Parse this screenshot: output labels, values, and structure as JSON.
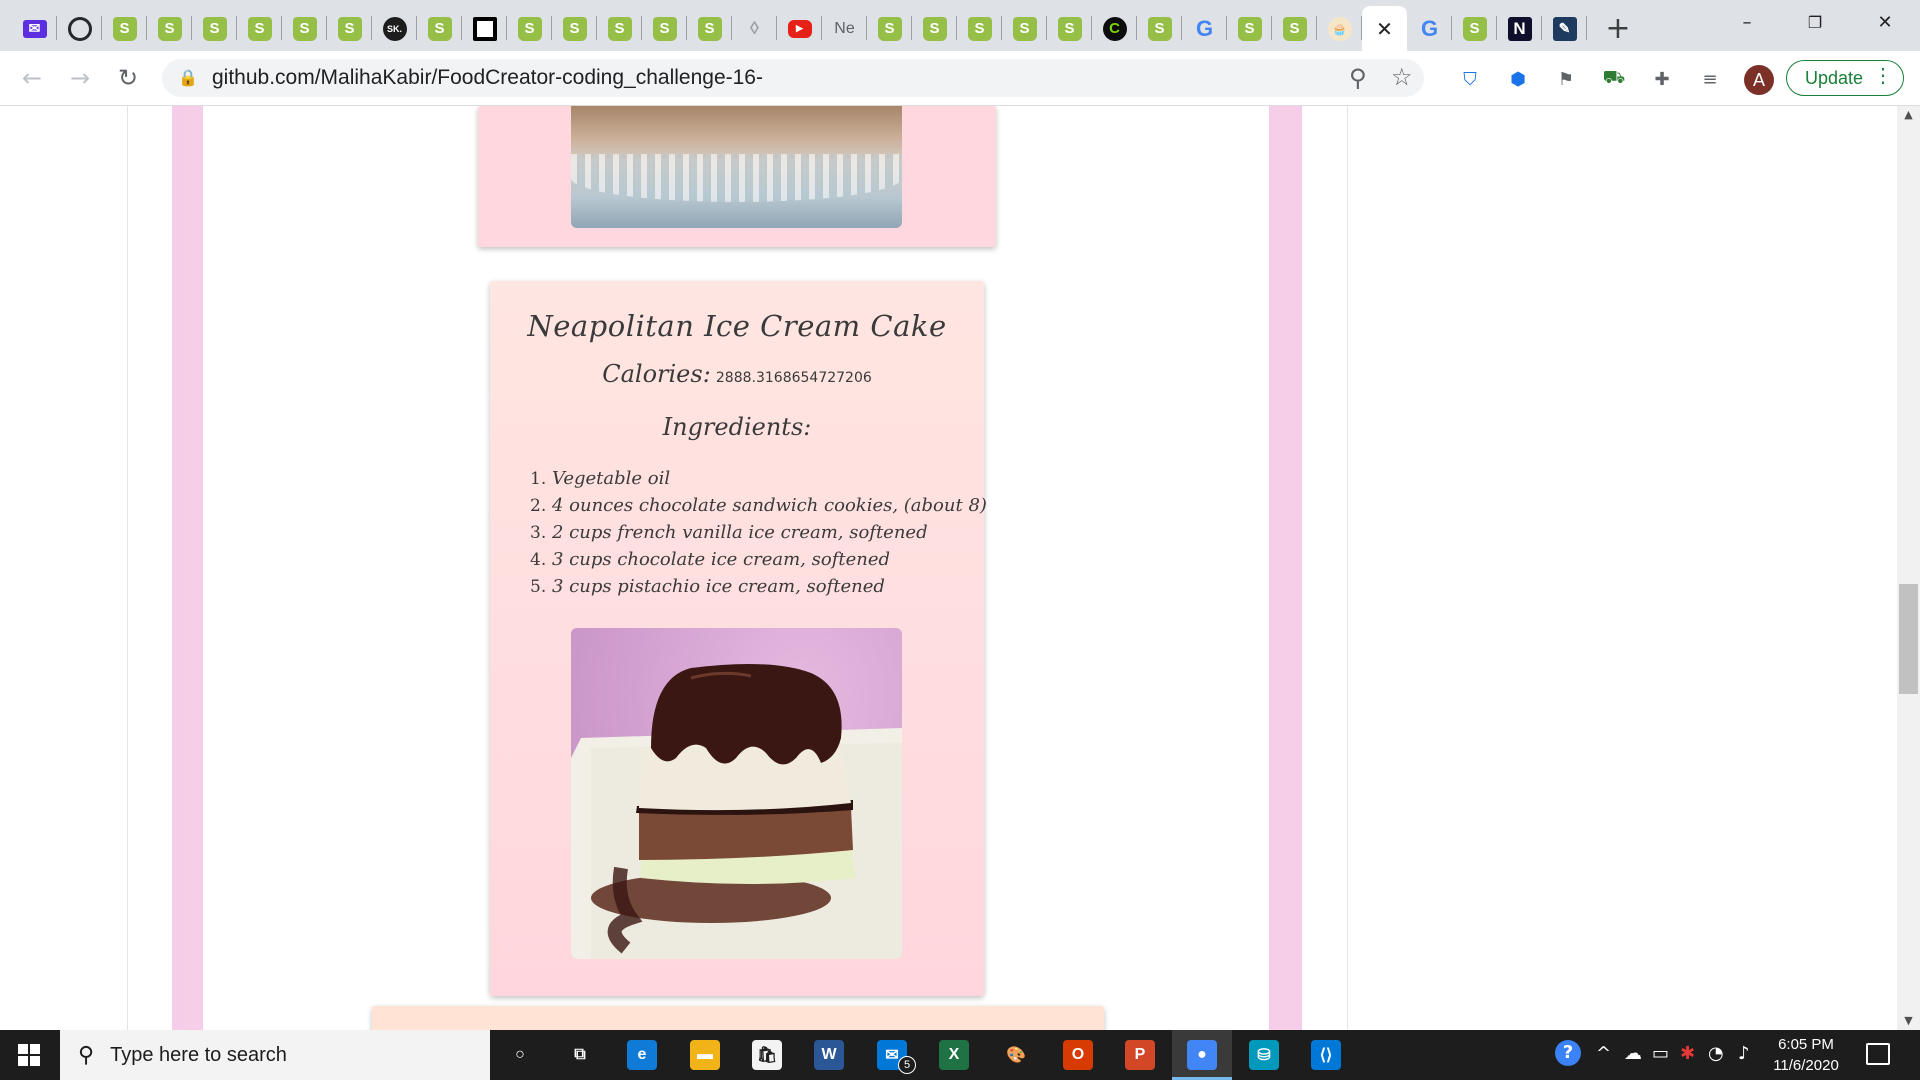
{
  "browser": {
    "tabs": [
      {
        "icon": "gmail-icon",
        "glyph": "✉"
      },
      {
        "icon": "github-icon",
        "glyph": ""
      },
      {
        "icon": "shopify-icon",
        "glyph": "S"
      },
      {
        "icon": "shopify-icon",
        "glyph": "S"
      },
      {
        "icon": "shopify-icon",
        "glyph": "S"
      },
      {
        "icon": "shopify-icon",
        "glyph": "S"
      },
      {
        "icon": "shopify-icon",
        "glyph": "S"
      },
      {
        "icon": "shopify-icon",
        "glyph": "S"
      },
      {
        "icon": "sk-icon",
        "glyph": "SK."
      },
      {
        "icon": "shopify-icon",
        "glyph": "S"
      },
      {
        "icon": "square-icon",
        "glyph": ""
      },
      {
        "icon": "shopify-icon",
        "glyph": "S"
      },
      {
        "icon": "shopify-icon",
        "glyph": "S"
      },
      {
        "icon": "shopify-icon",
        "glyph": "S"
      },
      {
        "icon": "shopify-icon",
        "glyph": "S"
      },
      {
        "icon": "shopify-icon",
        "glyph": "S"
      },
      {
        "icon": "droplet-icon",
        "glyph": "◊"
      },
      {
        "icon": "youtube-icon",
        "glyph": "▶"
      },
      {
        "icon": "ne-tab-label",
        "glyph": "Ne"
      },
      {
        "icon": "shopify-icon",
        "glyph": "S"
      },
      {
        "icon": "shopify-icon",
        "glyph": "S"
      },
      {
        "icon": "shopify-icon",
        "glyph": "S"
      },
      {
        "icon": "shopify-icon",
        "glyph": "S"
      },
      {
        "icon": "shopify-icon",
        "glyph": "S"
      },
      {
        "icon": "c-circle-icon",
        "glyph": "C"
      },
      {
        "icon": "shopify-icon",
        "glyph": "S"
      },
      {
        "icon": "google-icon",
        "glyph": "G"
      },
      {
        "icon": "shopify-icon",
        "glyph": "S"
      },
      {
        "icon": "shopify-icon",
        "glyph": "S"
      },
      {
        "icon": "cupcake-icon",
        "glyph": "🧁"
      },
      {
        "icon": "close-icon",
        "glyph": "✕",
        "active": true
      },
      {
        "icon": "google-icon",
        "glyph": "G"
      },
      {
        "icon": "shopify-icon",
        "glyph": "S"
      },
      {
        "icon": "notion-icon",
        "glyph": "N"
      },
      {
        "icon": "pen-icon",
        "glyph": "✎"
      }
    ],
    "new_tab_glyph": "+",
    "window_controls": {
      "minimize": "–",
      "restore": "❐",
      "close": "✕"
    },
    "back_glyph": "←",
    "forward_glyph": "→",
    "reload_glyph": "↻",
    "url": "github.com/MalihaKabir/FoodCreator-coding_challenge-16-",
    "lock_glyph": "🔒",
    "zoom_glyph": "⚲",
    "star_glyph": "☆",
    "extensions": [
      {
        "name": "shield-extension-icon",
        "glyph": "⛉",
        "color": "#1a73e8"
      },
      {
        "name": "location-extension-icon",
        "glyph": "⬢",
        "color": "#1a73e8"
      },
      {
        "name": "flag-extension-icon",
        "glyph": "⚑",
        "color": "#5f6368"
      },
      {
        "name": "cart-extension-icon",
        "glyph": "⛟",
        "color": "#2e7d32"
      },
      {
        "name": "puzzle-extensions-icon",
        "glyph": "✚",
        "color": "#5f6368"
      },
      {
        "name": "media-playlist-icon",
        "glyph": "≡",
        "color": "#5f6368"
      }
    ],
    "avatar_letter": "A",
    "update_label": "Update",
    "menu_glyph": "⋮"
  },
  "page": {
    "recipe": {
      "title": "Neapolitan Ice Cream Cake",
      "calories_label": "Calories:",
      "calories_value": "2888.3168654727206",
      "ingredients_heading": "Ingredients:",
      "ingredients": [
        {
          "num": "1.",
          "text": "Vegetable oil"
        },
        {
          "num": "2.",
          "text": "4 ounces chocolate sandwich cookies, (about 8)"
        },
        {
          "num": "3.",
          "text": "2 cups french vanilla ice cream, softened"
        },
        {
          "num": "4.",
          "text": "3 cups chocolate ice cream, softened"
        },
        {
          "num": "5.",
          "text": "3 cups pistachio ice cream, softened"
        }
      ]
    }
  },
  "taskbar": {
    "search_placeholder": "Type here to search",
    "apps": [
      {
        "name": "cortana-icon",
        "glyph": "○",
        "color": "transparent"
      },
      {
        "name": "task-view-icon",
        "glyph": "⧉",
        "color": "transparent"
      },
      {
        "name": "edge-icon",
        "glyph": "e",
        "color": "#0f7bd6"
      },
      {
        "name": "file-explorer-icon",
        "glyph": "▬",
        "color": "#f2b318"
      },
      {
        "name": "store-icon",
        "glyph": "🛍",
        "color": "#f3f3f3"
      },
      {
        "name": "word-icon",
        "glyph": "W",
        "color": "#2b5797"
      },
      {
        "name": "mail-icon",
        "glyph": "✉",
        "color": "#0078d7",
        "badge": "5"
      },
      {
        "name": "excel-icon",
        "glyph": "X",
        "color": "#1f7244"
      },
      {
        "name": "paint-icon",
        "glyph": "🎨",
        "color": "transparent"
      },
      {
        "name": "office-icon",
        "glyph": "O",
        "color": "#d83b01"
      },
      {
        "name": "powerpoint-icon",
        "glyph": "P",
        "color": "#d24726"
      },
      {
        "name": "chrome-icon",
        "glyph": "●",
        "color": "#4285f4",
        "active": true
      },
      {
        "name": "teams-icon",
        "glyph": "⛁",
        "color": "#0099bc"
      },
      {
        "name": "vscode-icon",
        "glyph": "⟨⟩",
        "color": "#0078d7"
      }
    ],
    "time": "6:05 PM",
    "date": "11/6/2020"
  },
  "colors": {
    "pink_frame": "#f6cde8",
    "card_pink": "#ffd6dd",
    "update_green": "#188038"
  }
}
